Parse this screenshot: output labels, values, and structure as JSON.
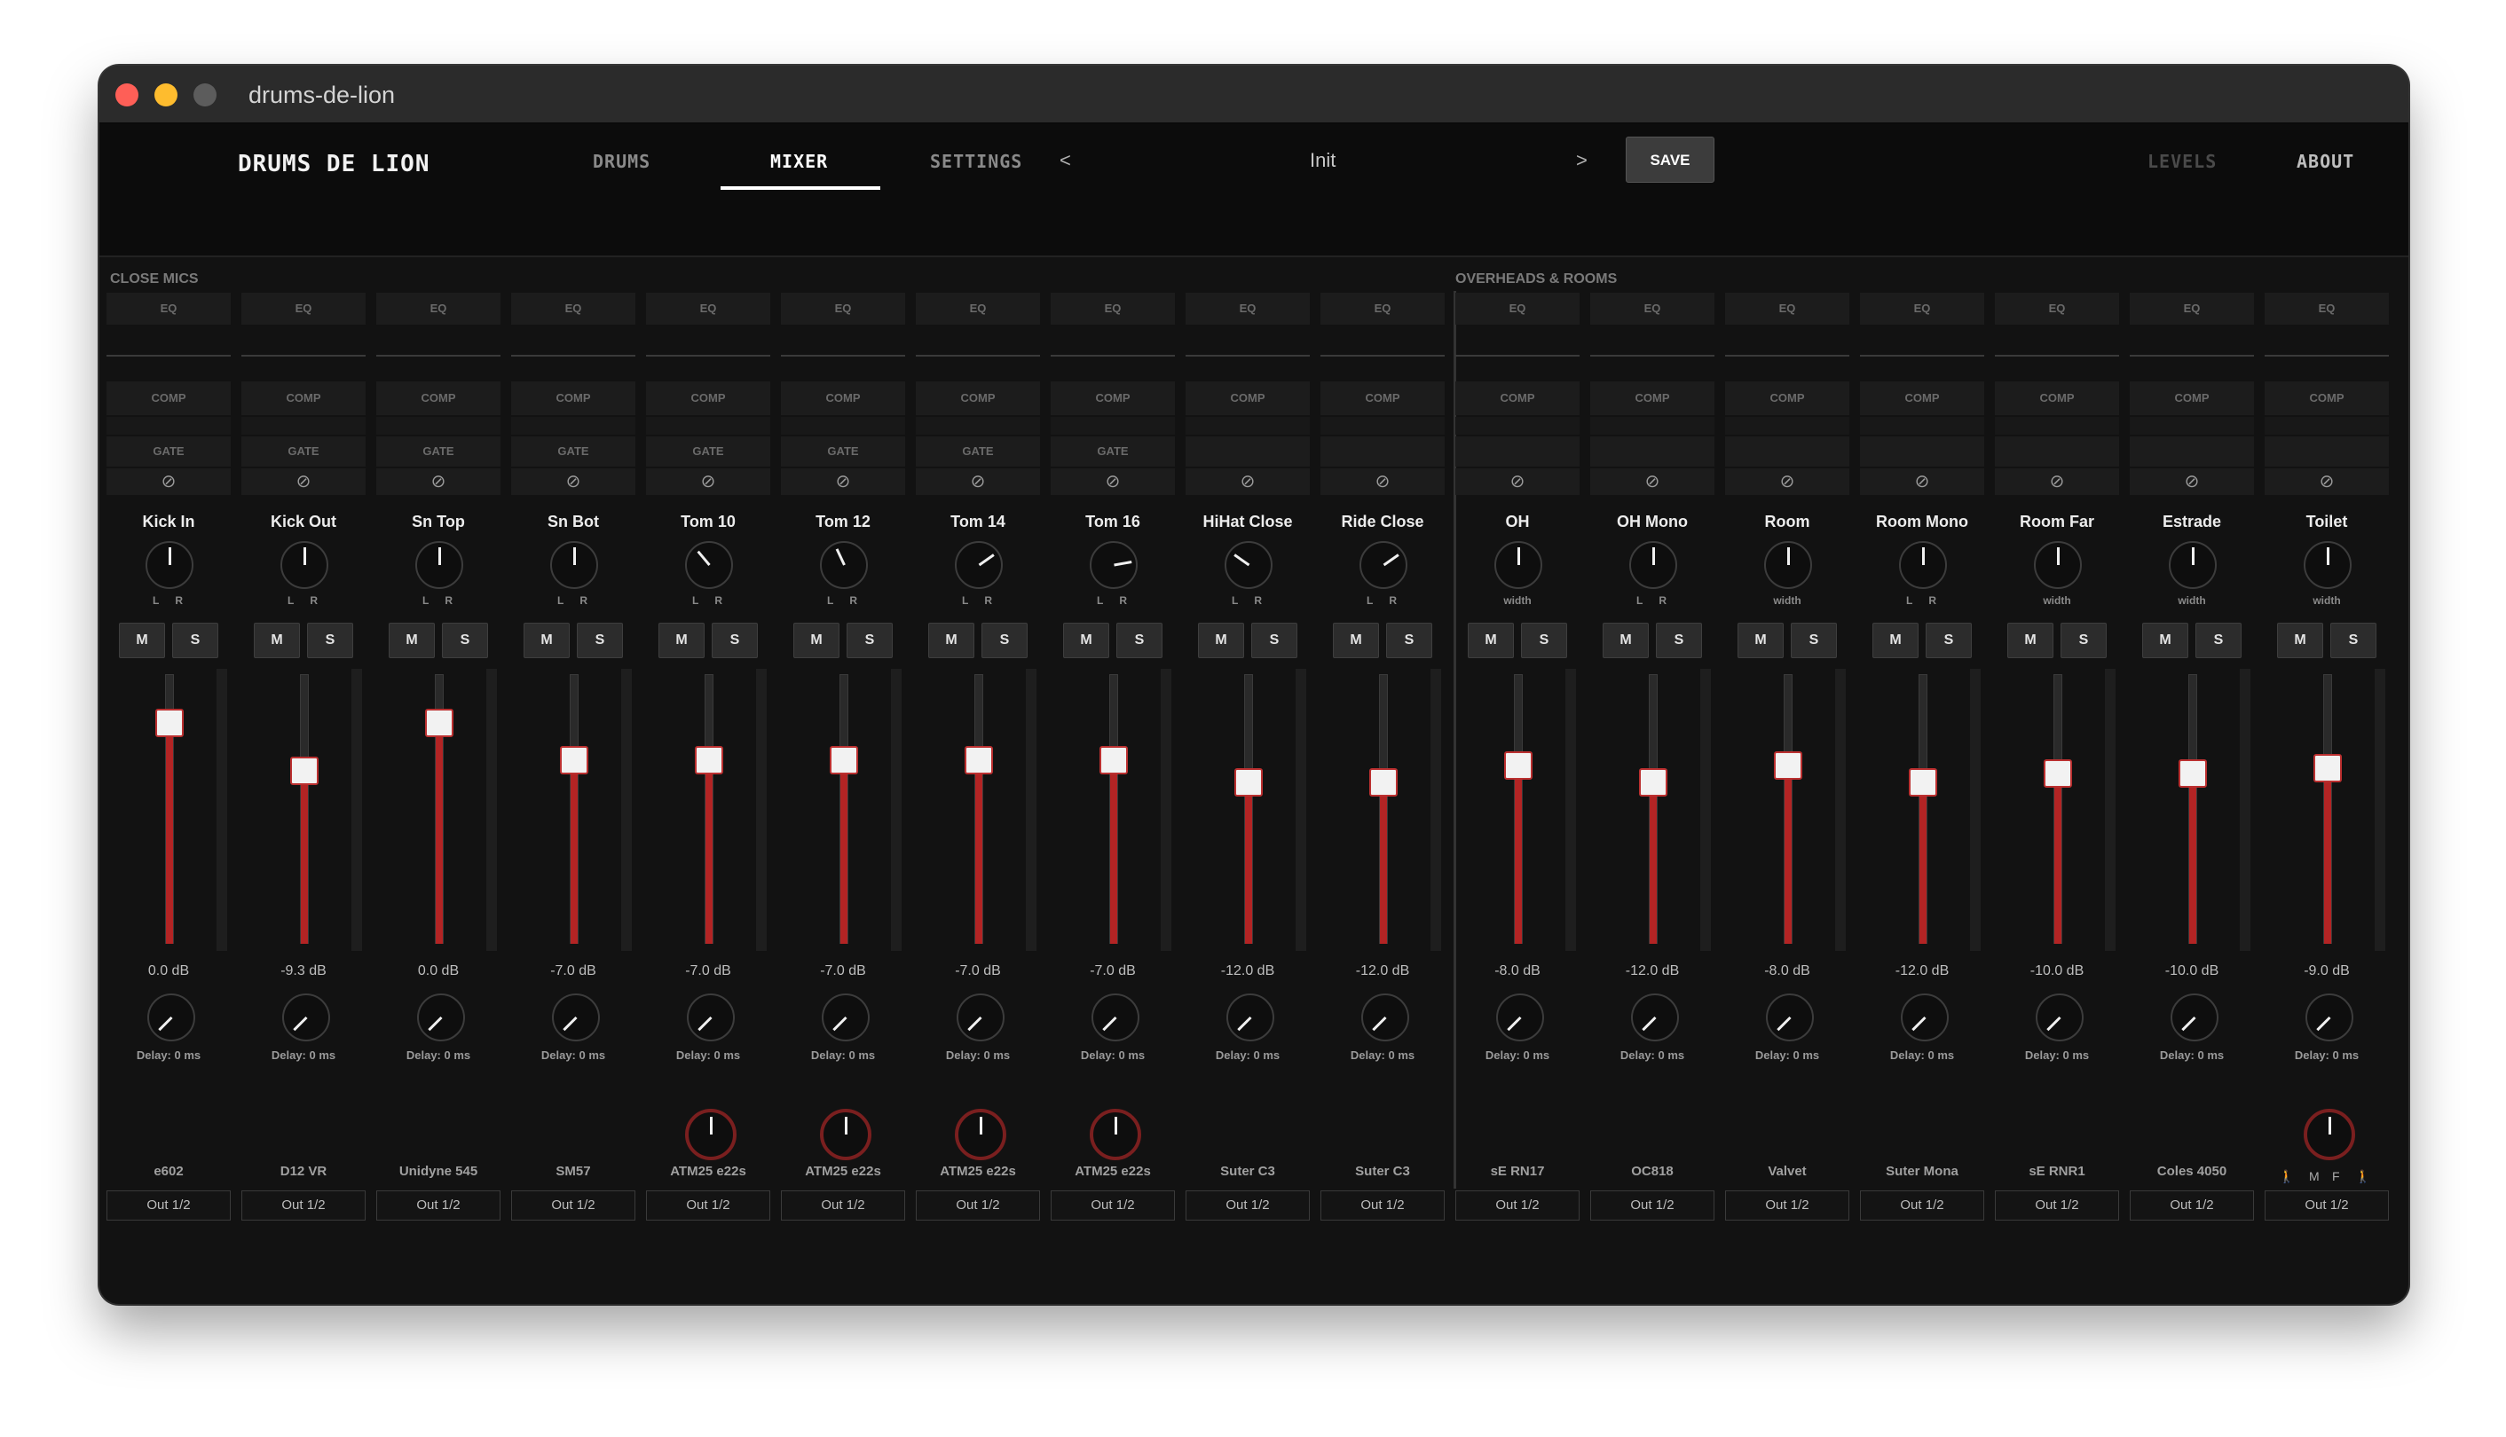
{
  "window": {
    "title": "drums-de-lion"
  },
  "header": {
    "logo": "DRUMS DE LION",
    "tabs": [
      {
        "label": "DRUMS",
        "active": false
      },
      {
        "label": "MIXER",
        "active": true
      },
      {
        "label": "SETTINGS",
        "active": false
      }
    ],
    "preset": {
      "prev": "<",
      "name": "Init",
      "next": ">"
    },
    "save_label": "SAVE",
    "levels_label": "LEVELS",
    "about_label": "ABOUT"
  },
  "sections": {
    "close_mics": "CLOSE MICS",
    "overheads_rooms": "OVERHEADS & ROOMS"
  },
  "labels": {
    "eq": "EQ",
    "comp": "COMP",
    "gate": "GATE",
    "phase": "⊘",
    "mute": "M",
    "solo": "S",
    "left": "L",
    "right": "R",
    "width": "width",
    "m": "M",
    "f": "F"
  },
  "colors": {
    "fader_fill": "#b32424",
    "accent": "#ffffff",
    "background": "#121212"
  },
  "channels": [
    {
      "name": "Kick In",
      "db": "0.0 dB",
      "delay": "Delay: 0 ms",
      "mic": "e602",
      "output": "Out 1/2",
      "gate": true,
      "pan_type": "lr",
      "level": 0.82,
      "pan_angle": 0,
      "color_knob": false
    },
    {
      "name": "Kick Out",
      "db": "-9.3 dB",
      "delay": "Delay: 0 ms",
      "mic": "D12 VR",
      "output": "Out 1/2",
      "gate": true,
      "pan_type": "lr",
      "level": 0.64,
      "pan_angle": 0,
      "color_knob": false
    },
    {
      "name": "Sn Top",
      "db": "0.0 dB",
      "delay": "Delay: 0 ms",
      "mic": "Unidyne 545",
      "output": "Out 1/2",
      "gate": true,
      "pan_type": "lr",
      "level": 0.82,
      "pan_angle": 0,
      "color_knob": false
    },
    {
      "name": "Sn Bot",
      "db": "-7.0 dB",
      "delay": "Delay: 0 ms",
      "mic": "SM57",
      "output": "Out 1/2",
      "gate": true,
      "pan_type": "lr",
      "level": 0.68,
      "pan_angle": 0,
      "color_knob": false
    },
    {
      "name": "Tom 10",
      "db": "-7.0 dB",
      "delay": "Delay: 0 ms",
      "mic": "ATM25  e22s",
      "output": "Out 1/2",
      "gate": true,
      "pan_type": "lr",
      "level": 0.68,
      "pan_angle": -40,
      "color_knob": true
    },
    {
      "name": "Tom 12",
      "db": "-7.0 dB",
      "delay": "Delay: 0 ms",
      "mic": "ATM25  e22s",
      "output": "Out 1/2",
      "gate": true,
      "pan_type": "lr",
      "level": 0.68,
      "pan_angle": -25,
      "color_knob": true
    },
    {
      "name": "Tom 14",
      "db": "-7.0 dB",
      "delay": "Delay: 0 ms",
      "mic": "ATM25  e22s",
      "output": "Out 1/2",
      "gate": true,
      "pan_type": "lr",
      "level": 0.68,
      "pan_angle": 55,
      "color_knob": true
    },
    {
      "name": "Tom 16",
      "db": "-7.0 dB",
      "delay": "Delay: 0 ms",
      "mic": "ATM25  e22s",
      "output": "Out 1/2",
      "gate": true,
      "pan_type": "lr",
      "level": 0.68,
      "pan_angle": 80,
      "color_knob": true
    },
    {
      "name": "HiHat Close",
      "db": "-12.0 dB",
      "delay": "Delay: 0 ms",
      "mic": "Suter C3",
      "output": "Out 1/2",
      "gate": false,
      "pan_type": "lr",
      "level": 0.6,
      "pan_angle": -55,
      "color_knob": false
    },
    {
      "name": "Ride Close",
      "db": "-12.0 dB",
      "delay": "Delay: 0 ms",
      "mic": "Suter C3",
      "output": "Out 1/2",
      "gate": false,
      "pan_type": "lr",
      "level": 0.6,
      "pan_angle": 55,
      "color_knob": false
    },
    {
      "name": "OH",
      "db": "-8.0 dB",
      "delay": "Delay: 0 ms",
      "mic": "sE RN17",
      "output": "Out 1/2",
      "gate": false,
      "pan_type": "width",
      "level": 0.66,
      "pan_angle": 0,
      "color_knob": false
    },
    {
      "name": "OH Mono",
      "db": "-12.0 dB",
      "delay": "Delay: 0 ms",
      "mic": "OC818",
      "output": "Out 1/2",
      "gate": false,
      "pan_type": "lr",
      "level": 0.6,
      "pan_angle": 0,
      "color_knob": false
    },
    {
      "name": "Room",
      "db": "-8.0 dB",
      "delay": "Delay: 0 ms",
      "mic": "Valvet",
      "output": "Out 1/2",
      "gate": false,
      "pan_type": "width",
      "level": 0.66,
      "pan_angle": 0,
      "color_knob": false
    },
    {
      "name": "Room Mono",
      "db": "-12.0 dB",
      "delay": "Delay: 0 ms",
      "mic": "Suter Mona",
      "output": "Out 1/2",
      "gate": false,
      "pan_type": "lr",
      "level": 0.6,
      "pan_angle": 0,
      "color_knob": false
    },
    {
      "name": "Room Far",
      "db": "-10.0 dB",
      "delay": "Delay: 0 ms",
      "mic": "sE RNR1",
      "output": "Out 1/2",
      "gate": false,
      "pan_type": "width",
      "level": 0.63,
      "pan_angle": 0,
      "color_knob": false
    },
    {
      "name": "Estrade",
      "db": "-10.0 dB",
      "delay": "Delay: 0 ms",
      "mic": "Coles 4050",
      "output": "Out 1/2",
      "gate": false,
      "pan_type": "width",
      "level": 0.63,
      "pan_angle": 0,
      "color_knob": false
    },
    {
      "name": "Toilet",
      "db": "-9.0 dB",
      "delay": "Delay: 0 ms",
      "mic": "",
      "output": "Out 1/2",
      "gate": false,
      "pan_type": "width",
      "level": 0.65,
      "pan_angle": 0,
      "color_knob": true,
      "mf_switch": true
    }
  ]
}
